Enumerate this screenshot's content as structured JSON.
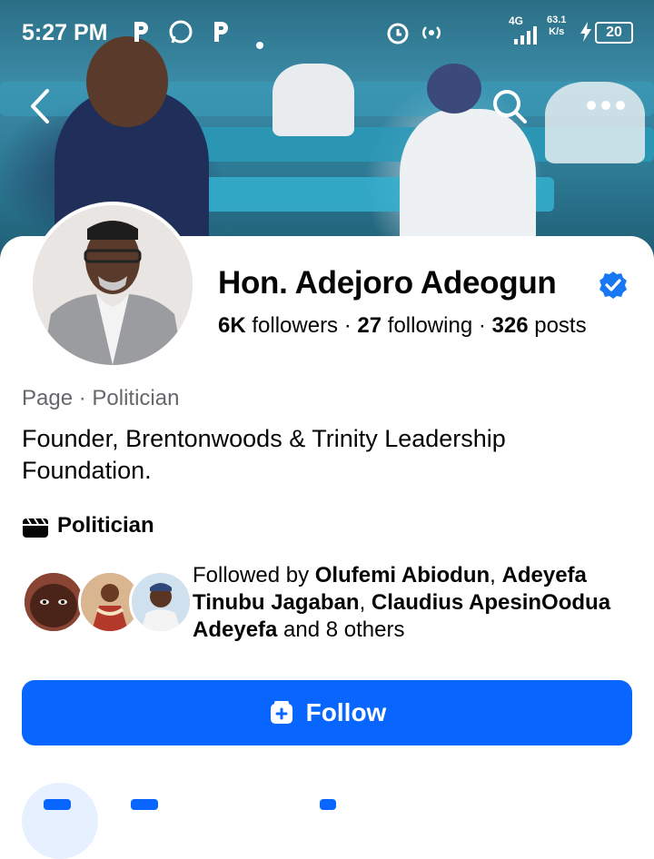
{
  "status_bar": {
    "time": "5:27 PM",
    "network": "4G",
    "speed": "63.1",
    "speed_unit": "K/s",
    "battery": "20"
  },
  "nav": {
    "back_icon": "back-arrow-icon",
    "search_icon": "search-icon",
    "more_icon": "more-icon"
  },
  "profile": {
    "name": "Hon. Adejoro Adeogun",
    "verified": true,
    "followers_count": "6K",
    "followers_label": "followers",
    "following_count": "27",
    "following_label": "following",
    "posts_count": "326",
    "posts_label": "posts",
    "category_line": "Page · Politician",
    "bio": "Founder, Brentonwoods & Trinity Leadership Foundation.",
    "detail_label": "Politician",
    "detail_icon": "clapperboard-icon"
  },
  "followed_by": {
    "prefix": "Followed by",
    "name1": "Olufemi Abiodun",
    "sep1": ",",
    "name2": "Adeyefa Tinubu Jagaban",
    "sep2": ",",
    "name3": "Claudius ApesinOodua Adeyefa",
    "suffix": "and 8 others"
  },
  "actions": {
    "follow_label": "Follow",
    "follow_icon": "follow-box-icon"
  },
  "colors": {
    "accent": "#0866ff",
    "secondary_text": "#65676b",
    "verified": "#1877f2"
  }
}
